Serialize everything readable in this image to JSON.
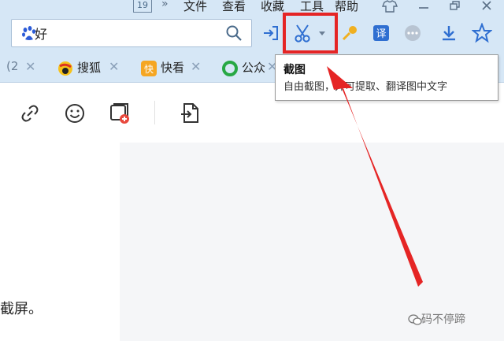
{
  "top_menu": {
    "badge": "19",
    "chevrons": "»",
    "items": [
      "文件",
      "查看",
      "收藏",
      "工具",
      "帮助"
    ]
  },
  "address_bar": {
    "value": "好"
  },
  "tabs": [
    {
      "label": "(2"
    },
    {
      "label": "搜狐"
    },
    {
      "label": "快看"
    },
    {
      "label": "公众"
    }
  ],
  "tooltip": {
    "title": "截图",
    "description": "自由截图，并可提取、翻译图中文字"
  },
  "content": {
    "visible_text": "截屏。"
  },
  "watermark": {
    "text": "码不停蹄"
  },
  "colors": {
    "toolbar_bg": "#d6e7f6",
    "highlight": "#e52525",
    "accent": "#1a66c9"
  }
}
